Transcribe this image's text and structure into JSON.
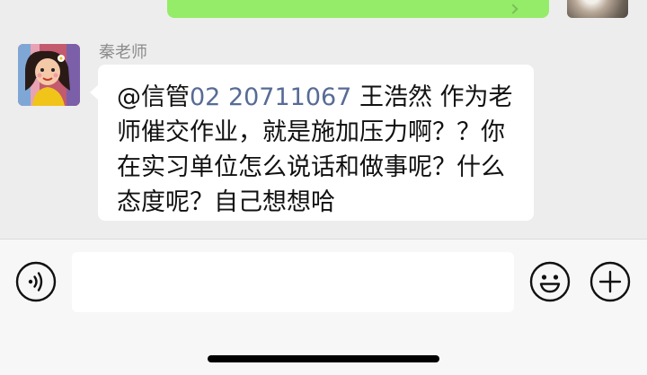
{
  "message": {
    "sender_name": "秦老师",
    "mention": "@信管",
    "phone": "02 20711067",
    "body": " 王浩然 作为老师催交作业，就是施加压力啊？？你在实习单位怎么说话和做事呢？什么态度呢？自己想想哈"
  },
  "input_bar": {
    "text_value": "",
    "voice_icon": "voice-input-icon",
    "emoji_icon": "emoji-icon",
    "plus_icon": "plus-icon"
  },
  "colors": {
    "own_bubble": "#95ec69",
    "chat_bg": "#ededed",
    "link": "#576b95",
    "input_bg": "#f7f7f7"
  }
}
